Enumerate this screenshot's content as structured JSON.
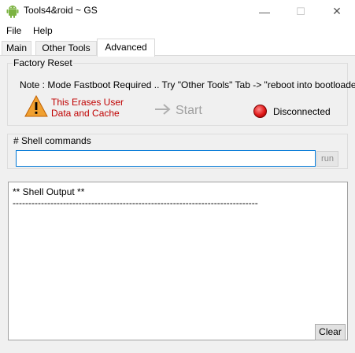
{
  "window": {
    "title": "Tools4&roid ~ GS",
    "icon": "android-icon",
    "controls": {
      "minimize": "—",
      "maximize": "☐",
      "close": "✕"
    }
  },
  "menu": {
    "file": "File",
    "help": "Help"
  },
  "tabs": [
    {
      "label": "Main",
      "active": false
    },
    {
      "label": "Other Tools",
      "active": false
    },
    {
      "label": "Advanced",
      "active": true
    }
  ],
  "factory_reset": {
    "title": "Factory Reset",
    "note": "Note : Mode Fastboot Required .. Try \"Other Tools\" Tab -> \"reboot into bootloader\"",
    "warning_line1": "This Erases User",
    "warning_line2": "Data and Cache",
    "start_label": "Start",
    "status": "Disconnected",
    "status_color": "#e01818",
    "warning_color": "#c00000"
  },
  "shell": {
    "title": "# Shell commands",
    "input_value": "",
    "run_label": "run"
  },
  "output": {
    "text": "** Shell Output **\n------------------------------------------------------------------------------",
    "clear_label": "Clear"
  }
}
